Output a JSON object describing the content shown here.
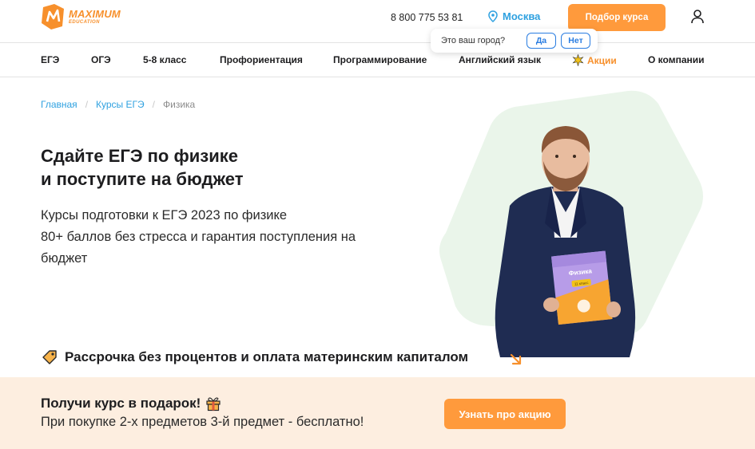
{
  "header": {
    "logo_main": "MAXIMUM",
    "logo_sub": "EDUCATION",
    "phone": "8 800 775 53 81",
    "city": "Москва",
    "cta_label": "Подбор курса",
    "brand_color": "#f7902c",
    "link_color": "#2fa1e0"
  },
  "city_popup": {
    "question": "Это ваш город?",
    "yes_label": "Да",
    "no_label": "Нет"
  },
  "nav": {
    "items": [
      "ЕГЭ",
      "ОГЭ",
      "5-8 класс",
      "Профориентация",
      "Программирование",
      "Английский язык",
      "Акции",
      "О компании"
    ]
  },
  "breadcrumbs": {
    "items": [
      "Главная",
      "Курсы ЕГЭ",
      "Физика"
    ]
  },
  "hero": {
    "title_line1": "Сдайте ЕГЭ по физике",
    "title_line2": "и поступите на бюджет",
    "subtitle_line1": "Курсы подготовки к ЕГЭ 2023 по физике",
    "subtitle_line2": "80+ баллов без стресса и гарантия поступления на",
    "subtitle_line3": "бюджет",
    "book_title": "Физика",
    "book_grade": "11 класс",
    "installment": "Рассрочка без процентов и оплата материнским капиталом"
  },
  "promo": {
    "title": "Получи курс в подарок!",
    "text": "При покупке 2-х предметов 3-й предмет - бесплатно!",
    "button": "Узнать про акцию",
    "background": "#fdeee0",
    "accent": "#ff9a3c"
  }
}
